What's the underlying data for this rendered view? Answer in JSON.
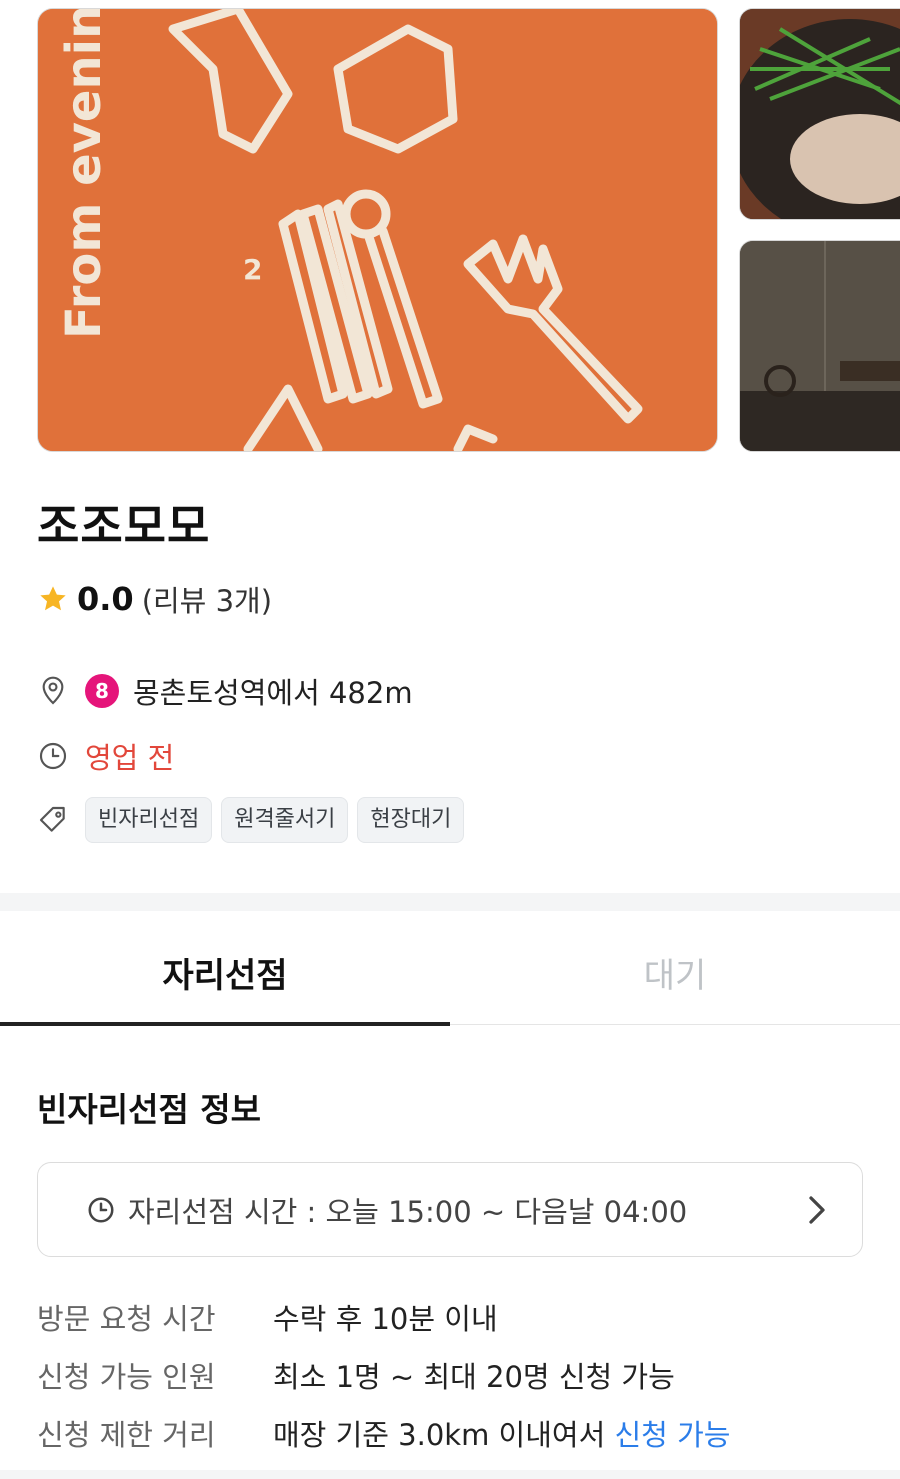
{
  "gallery": {
    "hero_caption": "From evening",
    "hero_color": "#e0713a"
  },
  "store": {
    "name": "조조모모",
    "rating": "0.0",
    "review_count": "(리뷰 3개)",
    "subway_line": "8",
    "subway_line_color": "#e5157a",
    "distance": "몽촌토성역에서 482m",
    "status": "영업 전",
    "tags": [
      "빈자리선점",
      "원격줄서기",
      "현장대기"
    ]
  },
  "tabs": [
    {
      "label": "자리선점",
      "active": true
    },
    {
      "label": "대기",
      "active": false
    }
  ],
  "section": {
    "title": "빈자리선점 정보",
    "time_text": "자리선점 시간 : 오늘 15:00 ~ 다음날 04:00"
  },
  "details": [
    {
      "key": "방문 요청 시간",
      "value": "수락 후 10분 이내"
    },
    {
      "key": "신청 가능 인원",
      "value": "최소 1명 ~ 최대 20명 신청 가능"
    },
    {
      "key": "신청 제한 거리",
      "value": "매장 기준 3.0km 이내여서 ",
      "value_highlight": "신청 가능"
    }
  ],
  "colors": {
    "accent_red": "#e2473b",
    "accent_orange": "#f05a28",
    "accent_blue": "#2b7de9"
  }
}
